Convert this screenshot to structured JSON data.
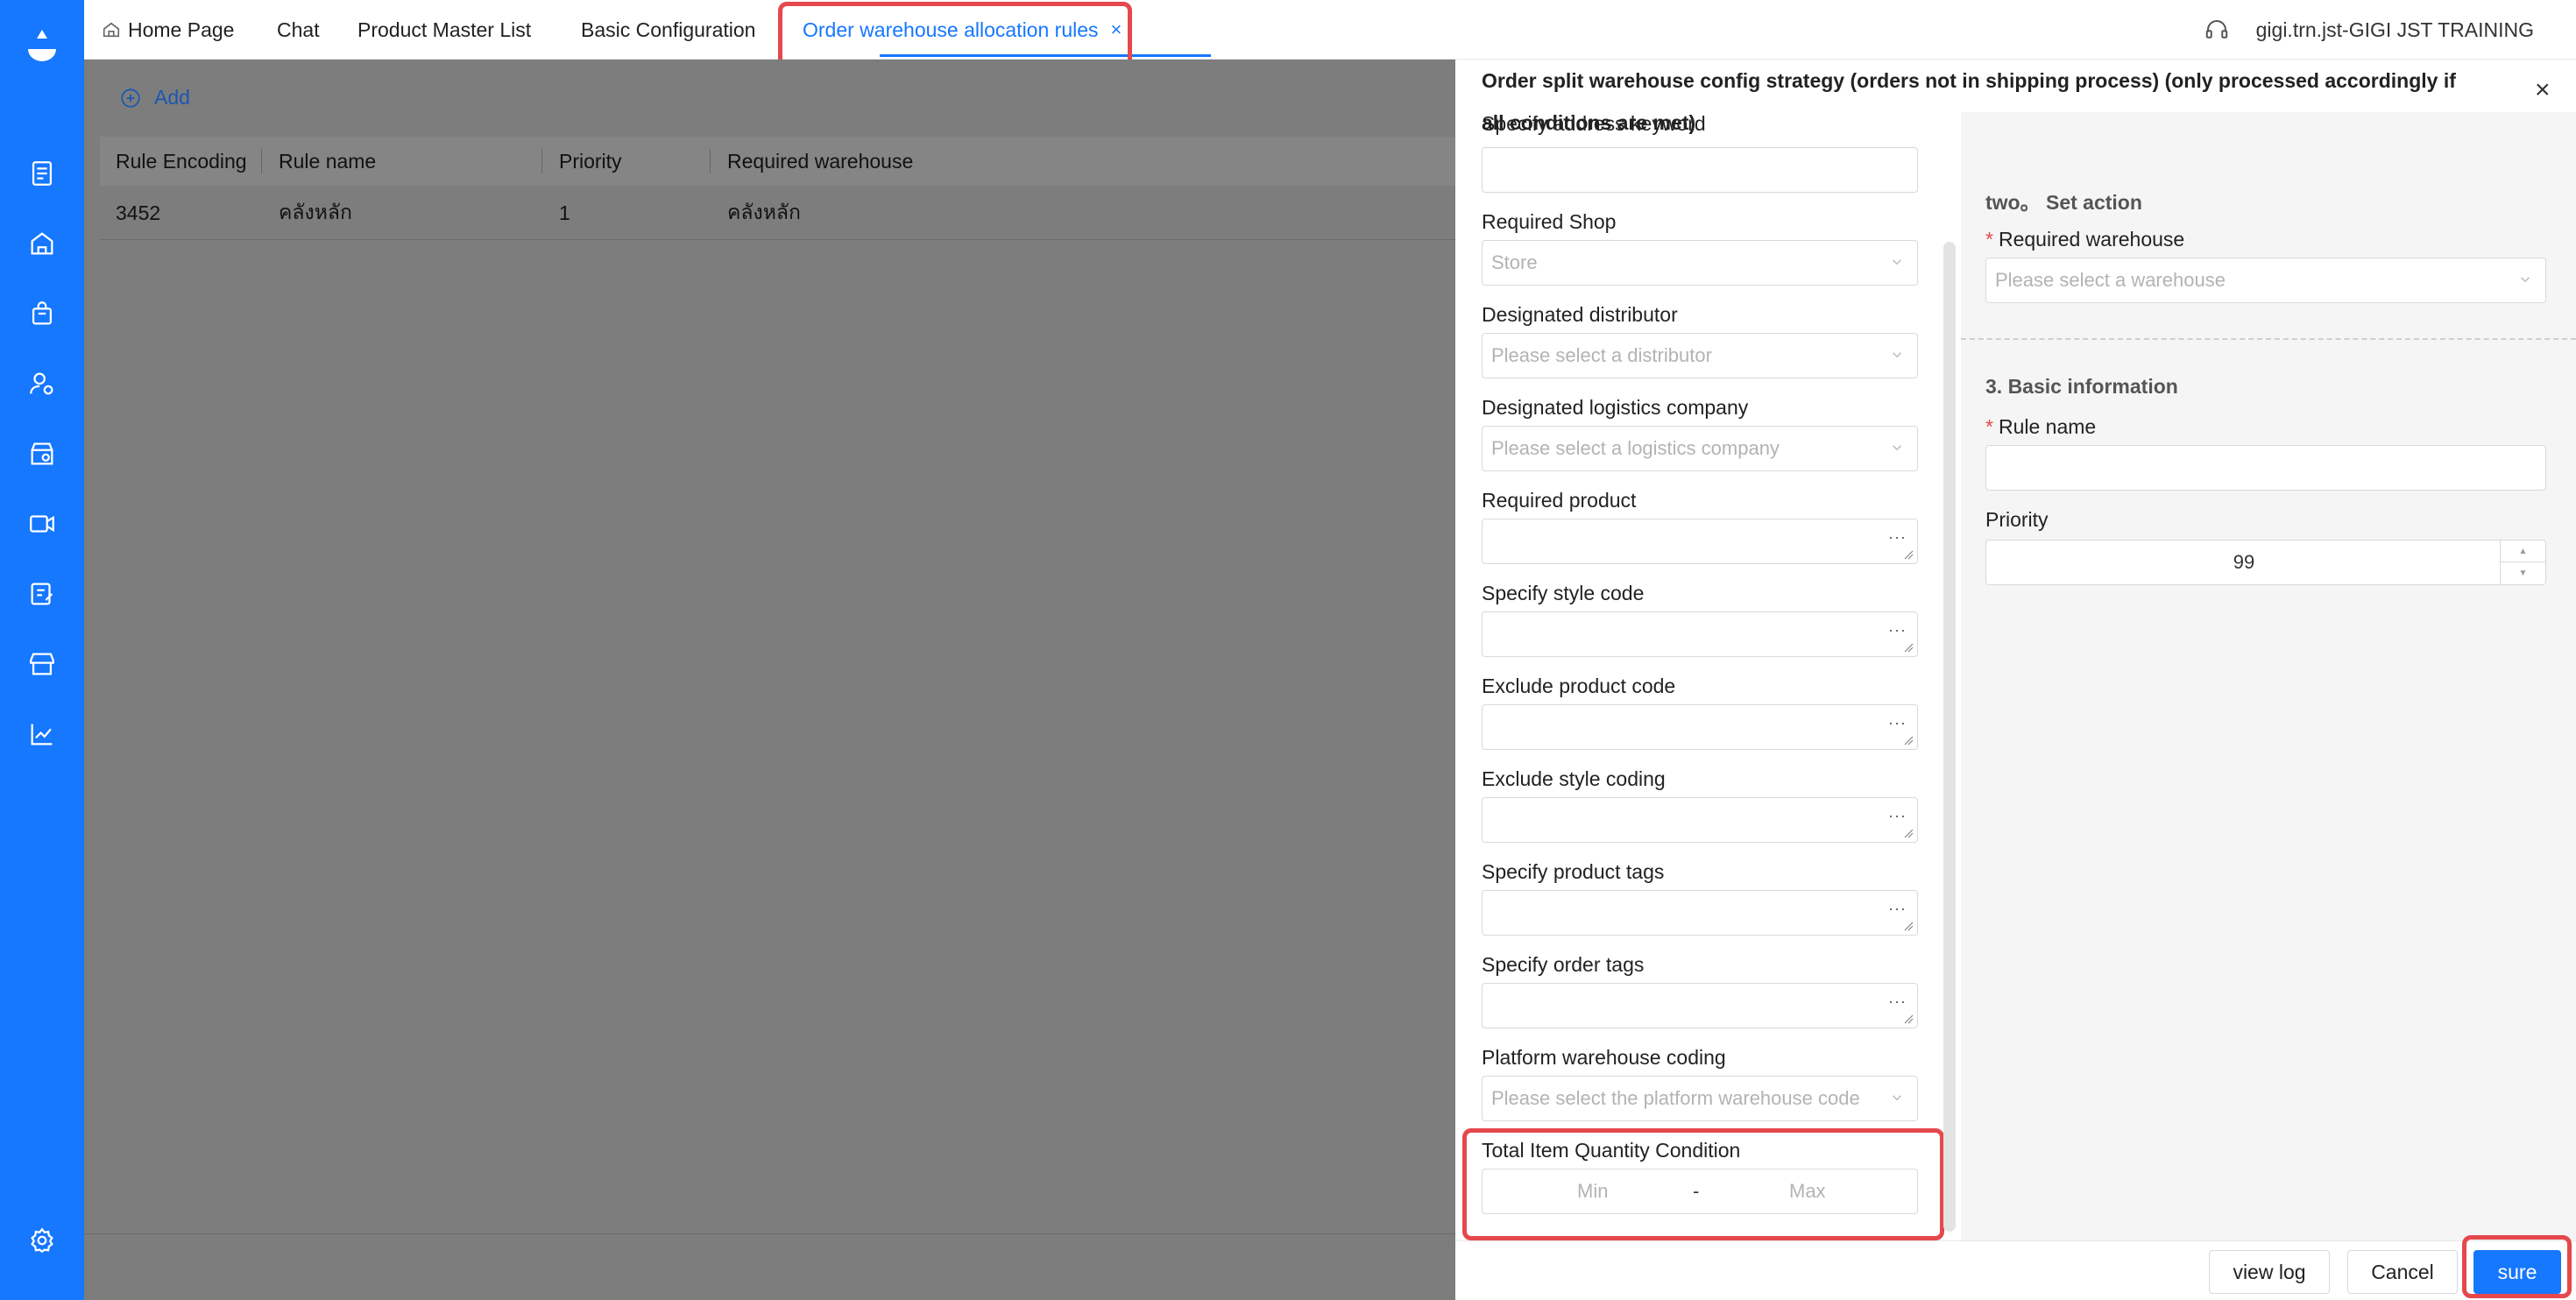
{
  "sidebar": {
    "logo": "droplet-logo-icon",
    "items": [
      "document-icon",
      "home-warehouse-icon",
      "shopping-bag-icon",
      "user-gear-icon",
      "store-setting-icon",
      "video-icon",
      "edit-list-icon",
      "shop-icon",
      "trend-chart-icon"
    ],
    "bottom_item": "settings-gear-icon"
  },
  "tabs": [
    {
      "label": "Home Page"
    },
    {
      "label": "Chat"
    },
    {
      "label": "Product Master List"
    },
    {
      "label": "Basic Configuration"
    },
    {
      "label": "Order warehouse allocation rules",
      "close": "×"
    }
  ],
  "user": {
    "name": "gigi.trn.jst-GIGI JST TRAINING"
  },
  "page": {
    "add_label": "Add",
    "columns": [
      "Rule Encoding",
      "Rule name",
      "Priority",
      "Required warehouse"
    ],
    "rows": [
      {
        "encoding": "3452",
        "name": "คลังหลัก",
        "priority": "1",
        "warehouse": "คลังหลัก"
      }
    ]
  },
  "drawer": {
    "title": "Order split warehouse config strategy (orders not in shipping process) (only processed accordingly if all conditions are met)",
    "close": "×",
    "fields": {
      "address_keyword": {
        "label": "Specify address keyword",
        "placeholder": ""
      },
      "required_shop": {
        "label": "Required Shop",
        "placeholder": "Store"
      },
      "distributor": {
        "label": "Designated distributor",
        "placeholder": "Please select a distributor"
      },
      "logistics": {
        "label": "Designated logistics company",
        "placeholder": "Please select a logistics company"
      },
      "required_product": {
        "label": "Required product"
      },
      "style_code": {
        "label": "Specify style code"
      },
      "exclude_product": {
        "label": "Exclude product code"
      },
      "exclude_style": {
        "label": "Exclude style coding"
      },
      "product_tags": {
        "label": "Specify product tags"
      },
      "order_tags": {
        "label": "Specify order tags"
      },
      "platform_wh": {
        "label": "Platform warehouse coding",
        "placeholder": "Please select the platform warehouse code"
      },
      "total_qty": {
        "label": "Total Item Quantity Condition",
        "min": "Min",
        "sep": "-",
        "max": "Max"
      }
    },
    "right": {
      "action_title": "two。 Set action",
      "warehouse_label": "Required warehouse",
      "warehouse_placeholder": "Please select a warehouse",
      "basic_title": "3. Basic information",
      "rule_name_label": "Rule name",
      "rule_name_value": "",
      "priority_label": "Priority",
      "priority_value": "99",
      "required_mark": "*"
    },
    "footer": {
      "view_log": "view log",
      "cancel": "Cancel",
      "sure": "sure"
    }
  }
}
